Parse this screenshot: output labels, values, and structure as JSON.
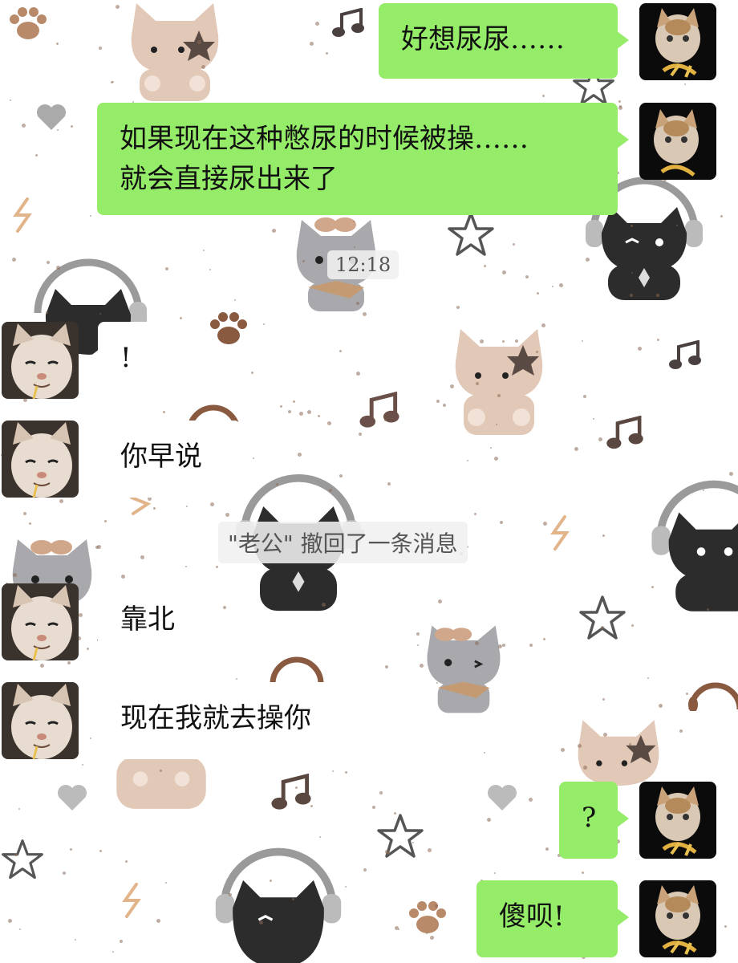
{
  "theme": {
    "outgoing_bubble": "#95ec69",
    "incoming_bubble": "#ffffff",
    "wallpaper": "white with cat, paw-print, music-note and star doodles"
  },
  "messages": [
    {
      "side": "out",
      "text": "好想尿尿……"
    },
    {
      "side": "out",
      "lines": [
        "如果现在这种憋尿的时候被操……",
        "就会直接尿出来了"
      ]
    },
    {
      "type": "timestamp",
      "text": "12:18"
    },
    {
      "side": "in",
      "text": "!"
    },
    {
      "side": "in",
      "text": "你早说"
    },
    {
      "type": "system",
      "text": "\"老公\" 撤回了一条消息"
    },
    {
      "side": "in",
      "text": "靠北"
    },
    {
      "side": "in",
      "text": "现在我就去操你"
    },
    {
      "side": "out",
      "text": "?"
    },
    {
      "side": "out",
      "text": "傻呗!"
    }
  ],
  "avatars": {
    "self": "cat-eating-fries",
    "other": "smiling-cat-closeup"
  }
}
